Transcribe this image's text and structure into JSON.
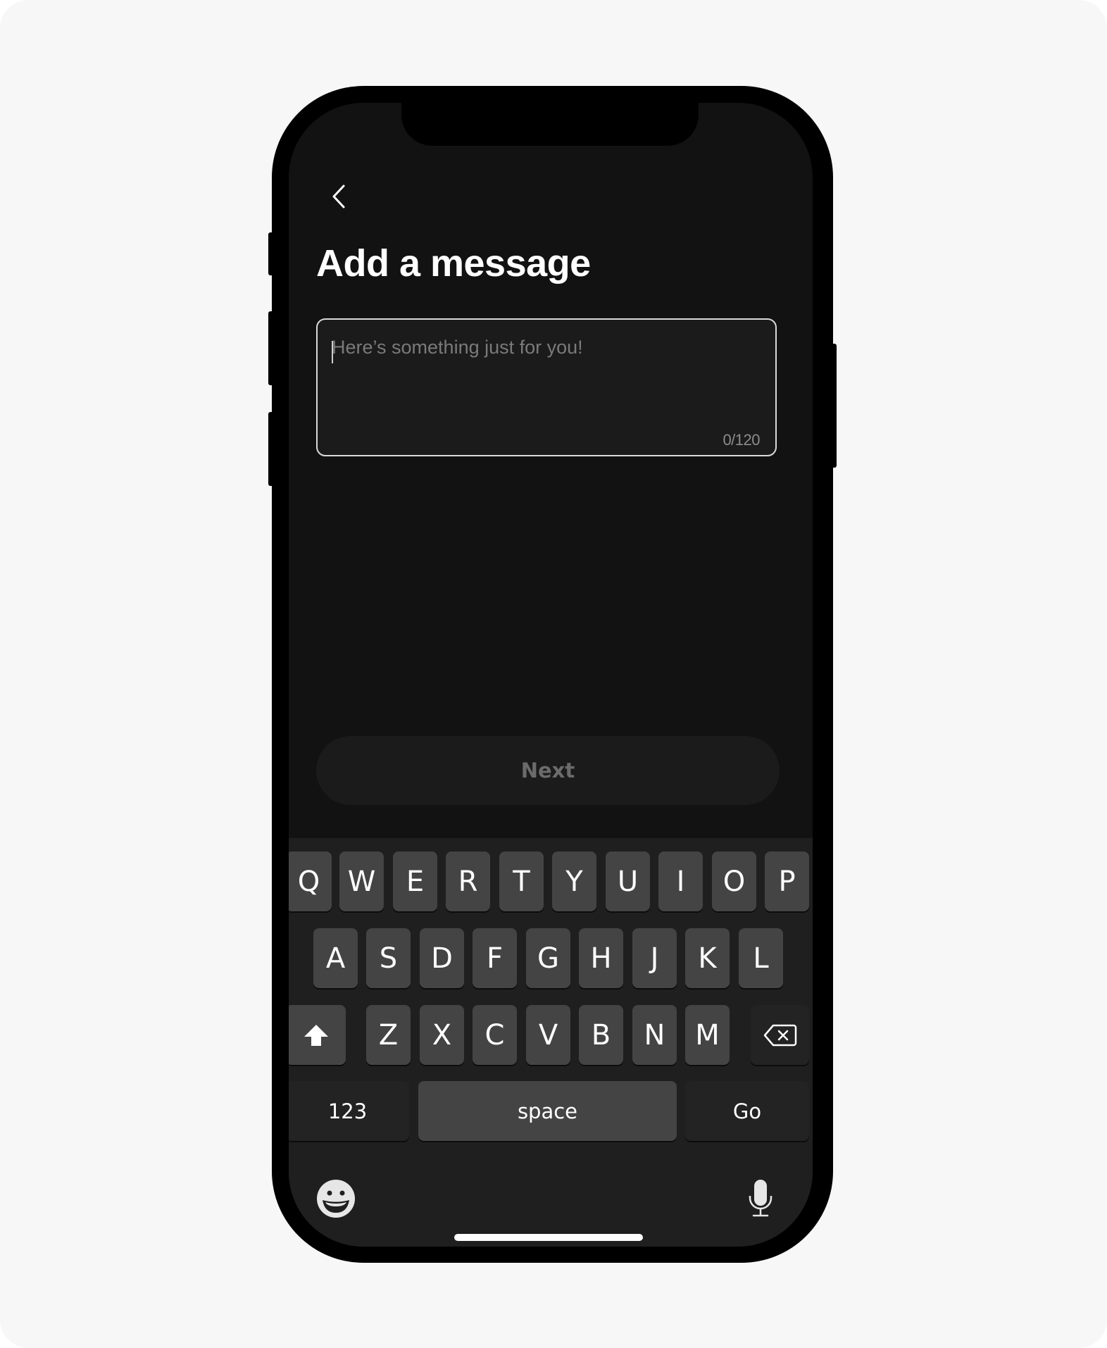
{
  "screen": {
    "title": "Add a message",
    "back_icon": "chevron-left-icon"
  },
  "message": {
    "placeholder": "Here’s something just for you!",
    "value": "",
    "counter": "0/120",
    "max_length": 120
  },
  "next_button": {
    "label": "Next",
    "enabled": false
  },
  "keyboard": {
    "row1": [
      "Q",
      "W",
      "E",
      "R",
      "T",
      "Y",
      "U",
      "I",
      "O",
      "P"
    ],
    "row2": [
      "A",
      "S",
      "D",
      "F",
      "G",
      "H",
      "J",
      "K",
      "L"
    ],
    "row3": [
      "Z",
      "X",
      "C",
      "V",
      "B",
      "N",
      "M"
    ],
    "shift_icon": "shift-arrow-icon",
    "backspace_icon": "backspace-icon",
    "numbers_label": "123",
    "space_label": "space",
    "go_label": "Go",
    "emoji_icon": "emoji-smile-icon",
    "mic_icon": "microphone-icon"
  },
  "colors": {
    "background": "#f7f7f7",
    "screen": "#121212",
    "field": "#1b1b1b",
    "field_border": "#d9d9d9",
    "key": "#444444",
    "keyboard": "#1f1f1f",
    "disabled_text": "#6b6b6b"
  }
}
